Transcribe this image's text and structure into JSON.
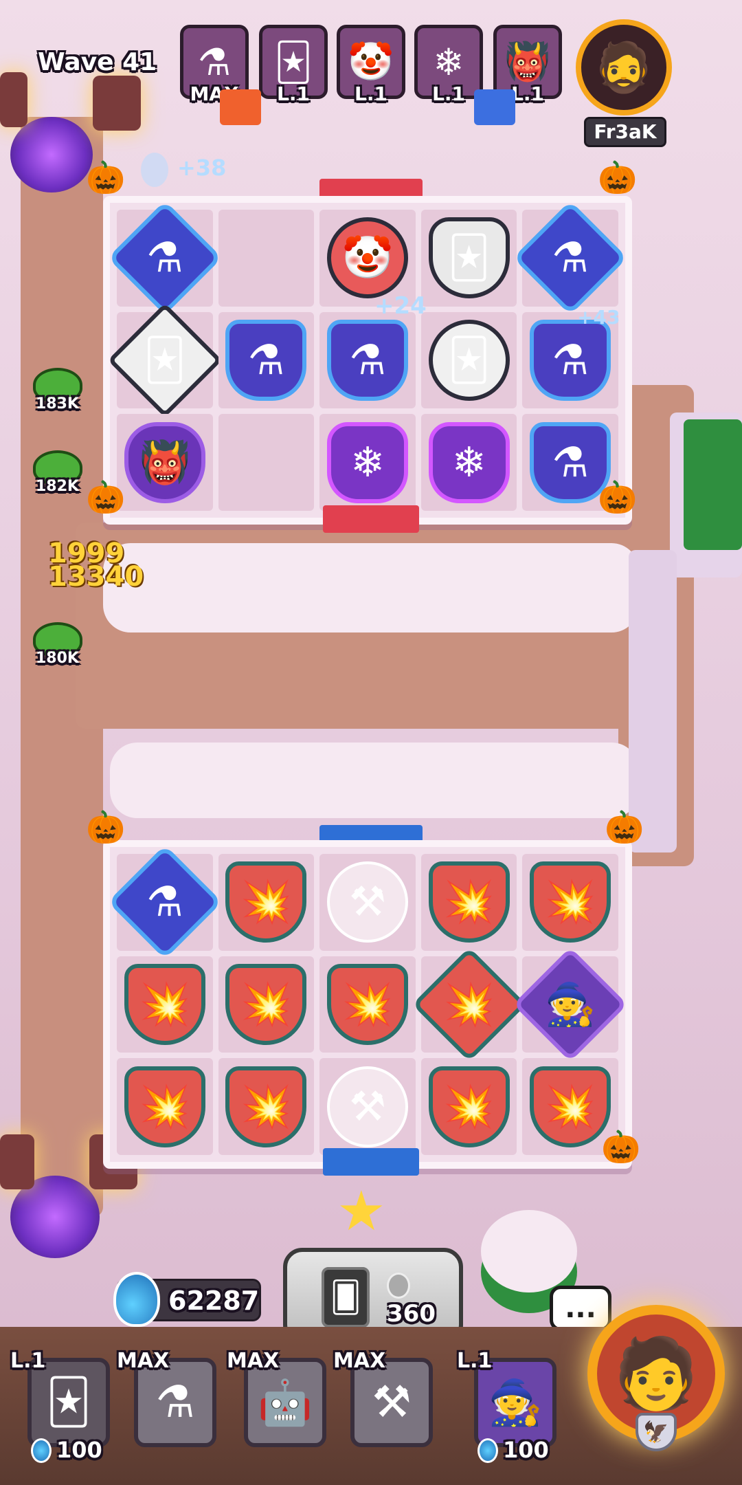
{
  "hud": {
    "wave_label": "Wave 41",
    "mana_gain": "+38",
    "float_text_1": "+24",
    "float_text_2": "+43",
    "damage_text": "1999\n13340"
  },
  "opponent": {
    "name": "Fr3aK",
    "avatar_icon": "bandit-avatar-icon",
    "deck": [
      {
        "level": "MAX",
        "icon": "cauldron-icon",
        "glyph": "⚗"
      },
      {
        "level": "L.1",
        "icon": "jester-white-icon",
        "glyph": "🃏"
      },
      {
        "level": "L.1",
        "icon": "jester-red-icon",
        "glyph": "🤡"
      },
      {
        "level": "L.1",
        "icon": "frost-mage-icon",
        "glyph": "❄"
      },
      {
        "level": "L.1",
        "icon": "demon-icon",
        "glyph": "👹"
      }
    ]
  },
  "enemies": [
    {
      "hp": "183K",
      "icon": "slime-icon"
    },
    {
      "hp": "182K",
      "icon": "slime-icon"
    },
    {
      "hp": "180K",
      "icon": "slime-icon"
    }
  ],
  "top_board": [
    [
      {
        "type": "u-blue",
        "glyph": "⚗"
      },
      {
        "type": "empty"
      },
      {
        "type": "u-jesterr",
        "glyph": "🤡"
      },
      {
        "type": "u-tri",
        "glyph": "🃏"
      },
      {
        "type": "u-blue",
        "glyph": "⚗"
      }
    ],
    [
      {
        "type": "u-diam",
        "glyph": "🃏"
      },
      {
        "type": "u-blueshield",
        "glyph": "⚗"
      },
      {
        "type": "u-blueshield",
        "glyph": "⚗"
      },
      {
        "type": "u-jesterw",
        "glyph": "🃏"
      },
      {
        "type": "u-blueshield",
        "glyph": "⚗"
      }
    ],
    [
      {
        "type": "u-purple",
        "glyph": "👹"
      },
      {
        "type": "empty"
      },
      {
        "type": "u-pink",
        "glyph": "❄"
      },
      {
        "type": "u-pink",
        "glyph": "❄"
      },
      {
        "type": "u-blueshield",
        "glyph": "⚗"
      }
    ]
  ],
  "bottom_board": [
    [
      {
        "type": "u-blue",
        "glyph": "⚗"
      },
      {
        "type": "u-red",
        "glyph": "💥"
      },
      {
        "type": "u-anvil",
        "glyph": "⚒"
      },
      {
        "type": "u-red",
        "glyph": "💥"
      },
      {
        "type": "u-red",
        "glyph": "💥"
      }
    ],
    [
      {
        "type": "u-red",
        "glyph": "💥"
      },
      {
        "type": "u-red",
        "glyph": "💥"
      },
      {
        "type": "u-red",
        "glyph": "💥"
      },
      {
        "type": "u-redd",
        "glyph": "💥"
      },
      {
        "type": "u-purpled",
        "glyph": "🧙"
      }
    ],
    [
      {
        "type": "u-red",
        "glyph": "💥"
      },
      {
        "type": "u-red",
        "glyph": "💥"
      },
      {
        "type": "u-anvil",
        "glyph": "⚒"
      },
      {
        "type": "u-red",
        "glyph": "💥"
      },
      {
        "type": "u-red",
        "glyph": "💥"
      }
    ]
  ],
  "player": {
    "mana": "62287",
    "summon_cost": "360",
    "hero_icon": "hero-bandana-icon",
    "chat_glyph": "...",
    "hand": [
      {
        "level": "L.1",
        "icon": "jester-white-icon",
        "glyph": "🃏",
        "cost": "100",
        "style": "dark"
      },
      {
        "level": "MAX",
        "icon": "cauldron-icon",
        "glyph": "⚗",
        "style": "grey"
      },
      {
        "level": "MAX",
        "icon": "robot-icon",
        "glyph": "🤖",
        "style": "grey"
      },
      {
        "level": "MAX",
        "icon": "anvil-icon",
        "glyph": "⚒",
        "style": "grey"
      },
      {
        "level": "L.1",
        "icon": "wizard-icon",
        "glyph": "🧙",
        "cost": "100",
        "style": "purple"
      }
    ]
  },
  "colors": {
    "accent_blue": "#4fa5f5",
    "accent_red": "#e1404f",
    "mana_blue": "#5fd0ff",
    "hero_gold": "#f6a51b"
  }
}
